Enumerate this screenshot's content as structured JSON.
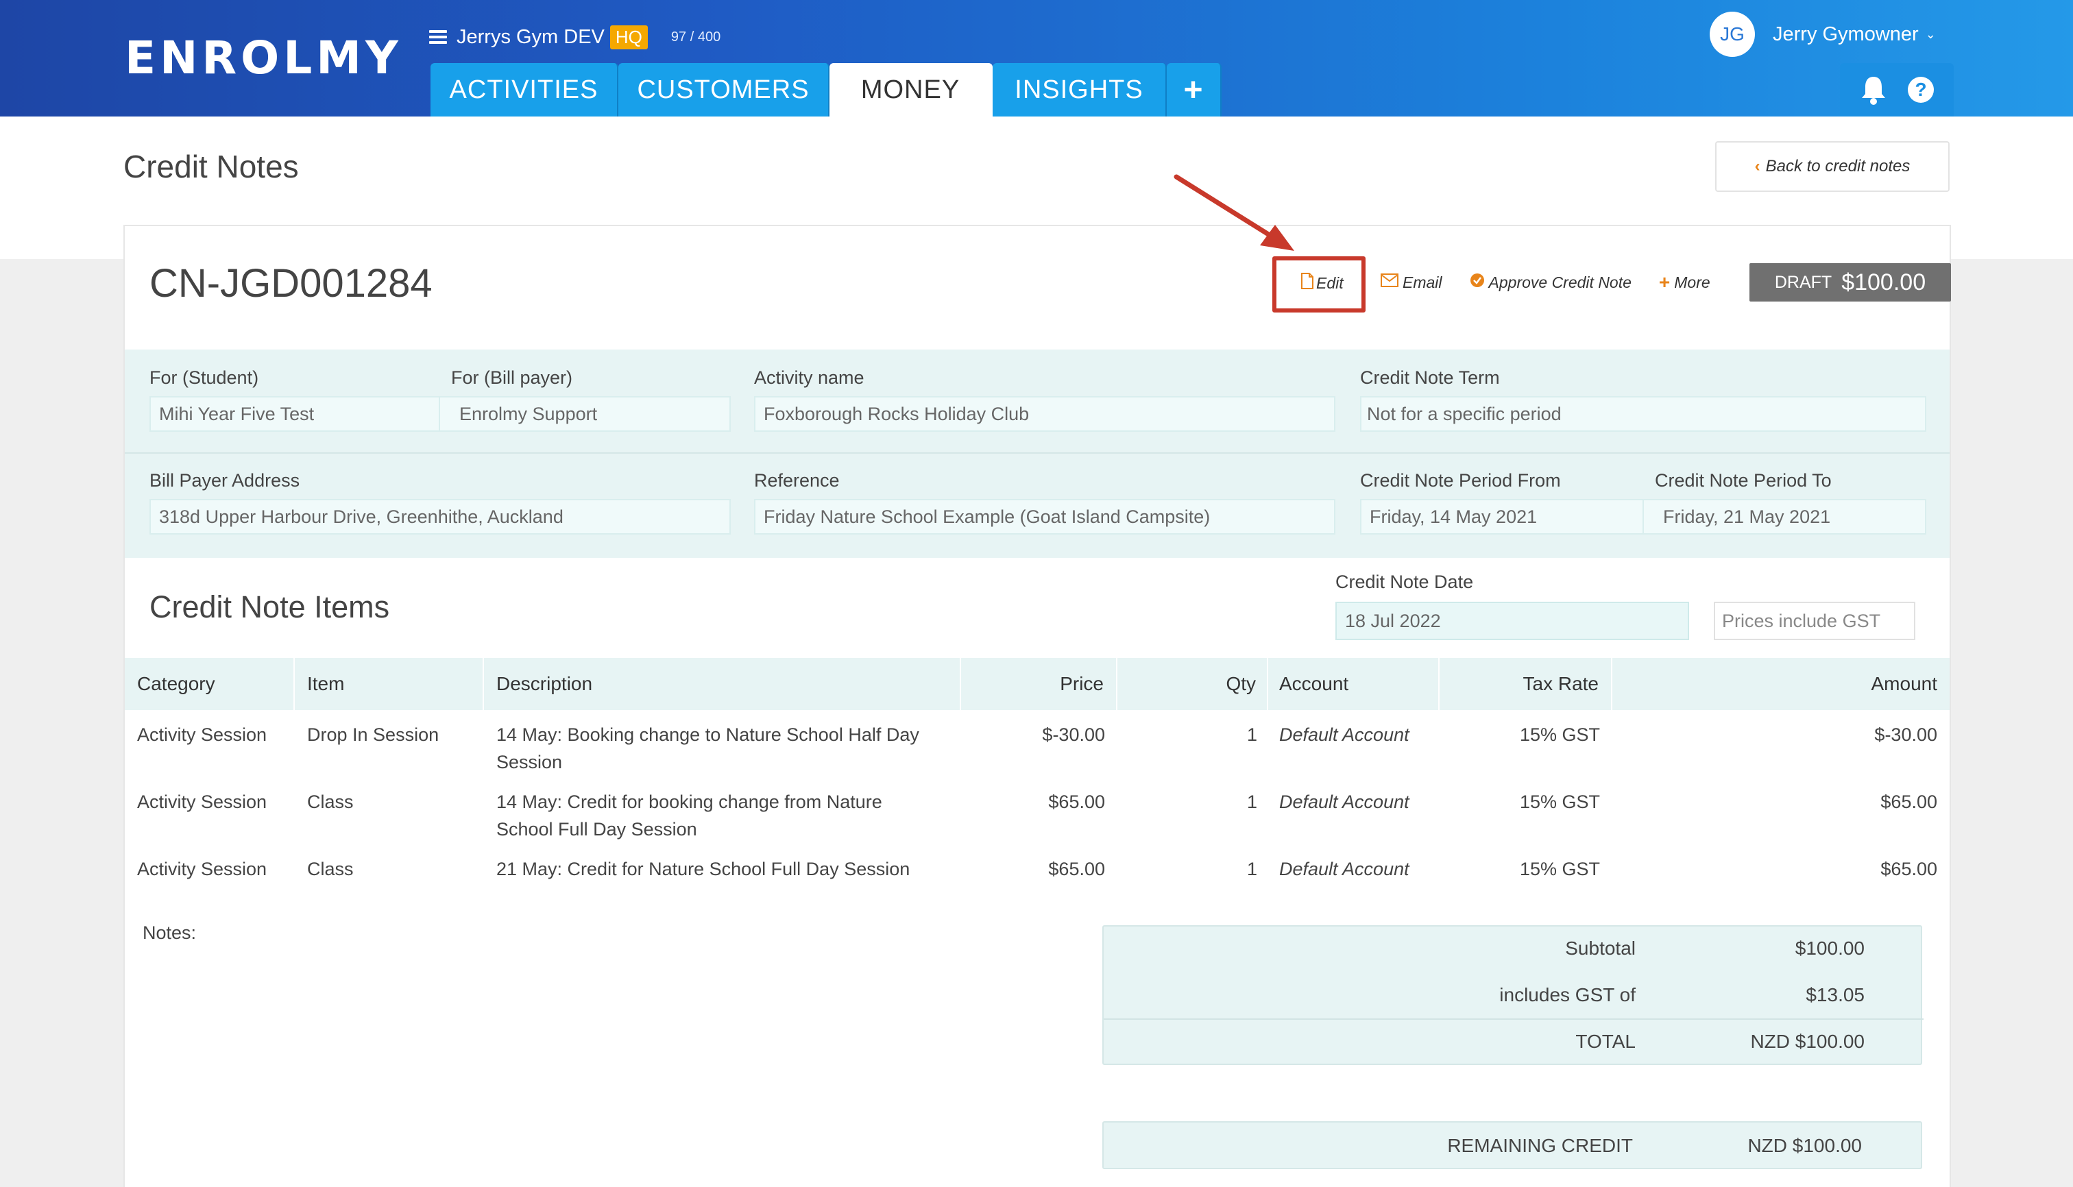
{
  "header": {
    "logo": "ENROLMY",
    "gym_name": "Jerrys Gym DEV",
    "hq_badge": "HQ",
    "quota": "97 / 400",
    "tabs": [
      {
        "label": "ACTIVITIES"
      },
      {
        "label": "CUSTOMERS"
      },
      {
        "label": "MONEY",
        "active": true
      },
      {
        "label": "INSIGHTS"
      },
      {
        "label": "+"
      }
    ],
    "user_initials": "JG",
    "user_name": "Jerry Gymowner"
  },
  "page": {
    "title": "Credit Notes",
    "back_button": "Back to credit notes"
  },
  "credit_note": {
    "number": "CN-JGD001284",
    "actions": {
      "edit": "Edit",
      "email": "Email",
      "approve": "Approve Credit Note",
      "more": "More"
    },
    "status": "DRAFT",
    "status_amount": "$100.00",
    "fields": {
      "student_label": "For (Student)",
      "student_value": "Mihi Year Five Test",
      "billpayer_label": "For (Bill payer)",
      "billpayer_value": "Enrolmy Support",
      "activity_label": "Activity name",
      "activity_value": "Foxborough Rocks Holiday Club",
      "term_label": "Credit Note Term",
      "term_value": "Not for a specific period",
      "address_label": "Bill Payer Address",
      "address_value": "318d Upper Harbour Drive, Greenhithe, Auckland",
      "reference_label": "Reference",
      "reference_value": "Friday Nature School Example (Goat Island Campsite)",
      "period_from_label": "Credit Note Period From",
      "period_from_value": "Friday, 14 May 2021",
      "period_to_label": "Credit Note Period To",
      "period_to_value": "Friday, 21 May 2021"
    },
    "items_title": "Credit Note Items",
    "date_label": "Credit Note Date",
    "date_value": "18 Jul 2022",
    "prices_option": "Prices include GST",
    "table": {
      "headers": [
        "Category",
        "Item",
        "Description",
        "Price",
        "Qty",
        "Account",
        "Tax Rate",
        "Amount"
      ],
      "rows": [
        {
          "category": "Activity Session",
          "item": "Drop In Session",
          "desc1": "14 May: Booking change to Nature School Half Day",
          "desc2": "Session",
          "price": "$-30.00",
          "qty": "1",
          "account": "Default Account",
          "tax": "15% GST",
          "amount": "$-30.00"
        },
        {
          "category": "Activity Session",
          "item": "Class",
          "desc1": "14 May: Credit for booking change from Nature",
          "desc2": "School Full Day Session",
          "price": "$65.00",
          "qty": "1",
          "account": "Default Account",
          "tax": "15% GST",
          "amount": "$65.00"
        },
        {
          "category": "Activity Session",
          "item": "Class",
          "desc1": "21 May: Credit for Nature School Full Day Session",
          "desc2": "",
          "price": "$65.00",
          "qty": "1",
          "account": "Default Account",
          "tax": "15% GST",
          "amount": "$65.00"
        }
      ]
    },
    "notes_label": "Notes:",
    "totals": {
      "subtotal_label": "Subtotal",
      "subtotal_value": "$100.00",
      "gst_label": "includes GST of",
      "gst_value": "$13.05",
      "total_label": "TOTAL",
      "total_value": "NZD $100.00",
      "remaining_label": "REMAINING CREDIT",
      "remaining_value": "NZD $100.00"
    }
  },
  "colors": {
    "accent_orange": "#e8841a",
    "highlight_red": "#c8392b",
    "tab_blue": "#18a0ea",
    "draft_grey": "#707070"
  }
}
